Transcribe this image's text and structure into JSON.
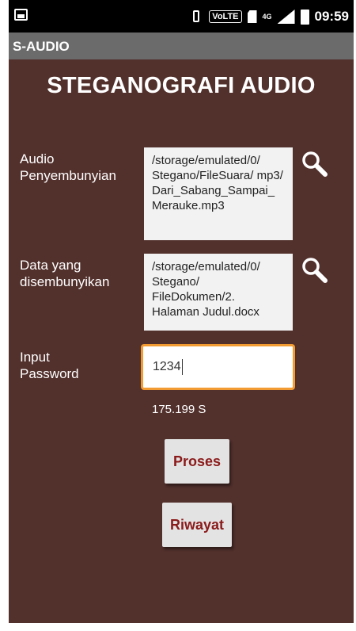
{
  "status_bar": {
    "volte": "VoLTE",
    "network": "4G",
    "clock": "09:59"
  },
  "app_bar": {
    "title": "S-AUDIO"
  },
  "main": {
    "title": "STEGANOGRAFI AUDIO",
    "audio": {
      "label_line1": "Audio",
      "label_line2": "Penyembunyian",
      "path": "/storage/emulated/0/ Stegano/FileSuara/ mp3/ Dari_Sabang_Sampai_ Merauke.mp3"
    },
    "data": {
      "label_line1": "Data yang",
      "label_line2": "disembunyikan",
      "path": "/storage/emulated/0/ Stegano/ FileDokumen/2. Halaman Judul.docx"
    },
    "password": {
      "label_line1": "Input",
      "label_line2": "Password",
      "value": "1234"
    },
    "elapsed_time": "175.199 S",
    "process_button": "Proses",
    "history_button": "Riwayat"
  },
  "colors": {
    "background": "#52302c",
    "app_bar": "#6b6b6b",
    "button_text": "#8b1a1a",
    "focus_border": "#f29b33"
  }
}
